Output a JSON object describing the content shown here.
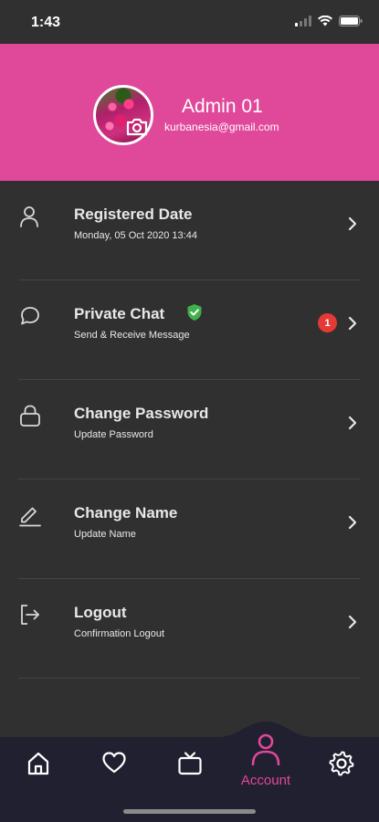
{
  "status_bar": {
    "time": "1:43",
    "icons": [
      "signal-icon",
      "wifi-icon",
      "battery-icon"
    ]
  },
  "profile": {
    "name": "Admin 01",
    "email": "kurbanesia@gmail.com",
    "avatar_icon": "flower-photo",
    "camera_icon": "camera-icon"
  },
  "menu": {
    "items": [
      {
        "title": "Registered Date",
        "subtitle": "Monday, 05 Oct 2020 13:44",
        "icon": "user-icon"
      },
      {
        "title": "Private Chat",
        "subtitle": "Send & Receive Message",
        "icon": "chat-bubble-icon",
        "badge": "1",
        "verified_icon": "shield-check-icon"
      },
      {
        "title": "Change Password",
        "subtitle": "Update Password",
        "icon": "lock-icon"
      },
      {
        "title": "Change Name",
        "subtitle": "Update Name",
        "icon": "pencil-icon"
      },
      {
        "title": "Logout",
        "subtitle": "Confirmation Logout",
        "icon": "logout-icon"
      }
    ]
  },
  "bottom_nav": {
    "items": [
      {
        "icon": "home-icon"
      },
      {
        "icon": "heart-icon"
      },
      {
        "icon": "tv-icon"
      },
      {
        "icon": "user-icon",
        "label": "Account",
        "active": true
      },
      {
        "icon": "gear-icon"
      }
    ]
  },
  "colors": {
    "accent": "#e0489a",
    "background": "#303030",
    "nav_background": "#202030",
    "badge": "#e53935",
    "verified": "#3fb14a"
  }
}
